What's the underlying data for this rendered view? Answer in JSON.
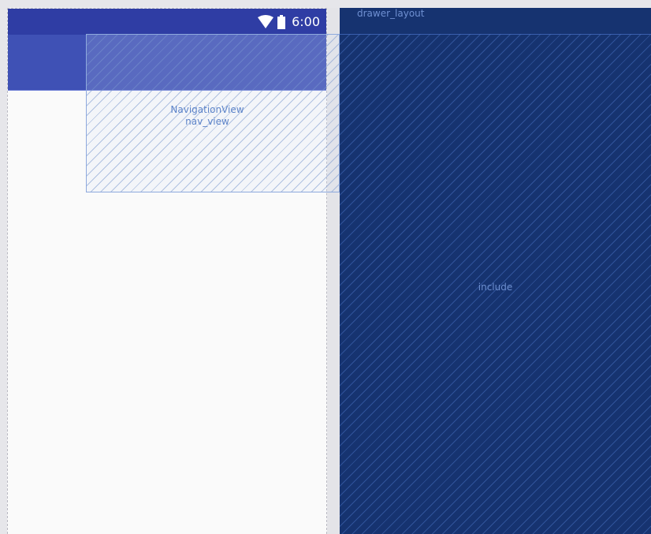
{
  "status_bar": {
    "time": "6:00",
    "wifi_icon": "wifi-icon",
    "battery_icon": "battery-icon",
    "color": "#2f3da4"
  },
  "app_bar": {
    "color": "#3f51b5"
  },
  "nav_view": {
    "class_label": "NavigationView",
    "id_label": "nav_view"
  },
  "blueprint": {
    "drawer_label": "drawer_layout",
    "include_label": "include",
    "color": "#163370"
  }
}
